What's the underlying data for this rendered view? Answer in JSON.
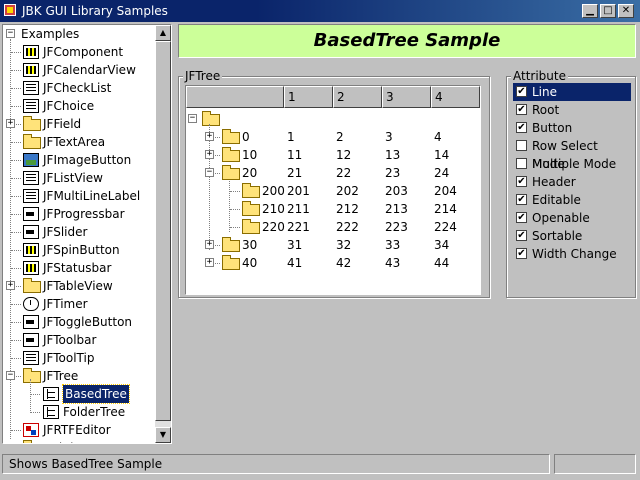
{
  "window": {
    "title": "JBK GUI Library Samples"
  },
  "nav": {
    "root_label": "Examples",
    "items": [
      {
        "label": "JFComponent",
        "icon": "component-icon",
        "expandable": false
      },
      {
        "label": "JFCalendarView",
        "icon": "calendar-icon",
        "expandable": false
      },
      {
        "label": "JFCheckList",
        "icon": "checklist-icon",
        "expandable": false
      },
      {
        "label": "JFChoice",
        "icon": "choice-icon",
        "expandable": false
      },
      {
        "label": "JFField",
        "icon": "folder-icon",
        "expandable": true
      },
      {
        "label": "JFTextArea",
        "icon": "folder-icon",
        "expandable": false
      },
      {
        "label": "JFImageButton",
        "icon": "image-button-icon",
        "expandable": false
      },
      {
        "label": "JFListView",
        "icon": "listview-icon",
        "expandable": false
      },
      {
        "label": "JFMultiLineLabel",
        "icon": "label-icon",
        "expandable": false
      },
      {
        "label": "JFProgressbar",
        "icon": "progressbar-icon",
        "expandable": false
      },
      {
        "label": "JFSlider",
        "icon": "slider-icon",
        "expandable": false
      },
      {
        "label": "JFSpinButton",
        "icon": "spinbutton-icon",
        "expandable": false
      },
      {
        "label": "JFStatusbar",
        "icon": "statusbar-icon",
        "expandable": false
      },
      {
        "label": "JFTableView",
        "icon": "folder-icon",
        "expandable": true
      },
      {
        "label": "JFTimer",
        "icon": "timer-icon",
        "expandable": false
      },
      {
        "label": "JFToggleButton",
        "icon": "toggle-icon",
        "expandable": false
      },
      {
        "label": "JFToolbar",
        "icon": "toolbar-icon",
        "expandable": false
      },
      {
        "label": "JFToolTip",
        "icon": "tooltip-icon",
        "expandable": false
      },
      {
        "label": "JFTree",
        "icon": "folder-open-icon",
        "expandable": true,
        "expanded": true
      },
      {
        "label": "BasedTree",
        "icon": "tree-icon",
        "child": true,
        "selected": true
      },
      {
        "label": "FolderTree",
        "icon": "tree-icon",
        "child": true
      },
      {
        "label": "JFRTFEditor",
        "icon": "rtf-icon",
        "expandable": false
      },
      {
        "label": "DciView",
        "icon": "folder-icon",
        "expandable": false
      }
    ]
  },
  "header": {
    "title": "BasedTree Sample"
  },
  "jftree": {
    "group_title": "JFTree",
    "columns": [
      "",
      "1",
      "2",
      "3",
      "4"
    ],
    "rows": [
      {
        "label": "0",
        "values": [
          "1",
          "2",
          "3",
          "4"
        ],
        "level": 1,
        "expandable": true,
        "expanded": false
      },
      {
        "label": "10",
        "values": [
          "11",
          "12",
          "13",
          "14"
        ],
        "level": 1,
        "expandable": true,
        "expanded": false
      },
      {
        "label": "20",
        "values": [
          "21",
          "22",
          "23",
          "24"
        ],
        "level": 1,
        "expandable": true,
        "expanded": true
      },
      {
        "label": "200",
        "values": [
          "201",
          "202",
          "203",
          "204"
        ],
        "level": 2,
        "expandable": false
      },
      {
        "label": "210",
        "values": [
          "211",
          "212",
          "213",
          "214"
        ],
        "level": 2,
        "expandable": false
      },
      {
        "label": "220",
        "values": [
          "221",
          "222",
          "223",
          "224"
        ],
        "level": 2,
        "expandable": false
      },
      {
        "label": "30",
        "values": [
          "31",
          "32",
          "33",
          "34"
        ],
        "level": 1,
        "expandable": true,
        "expanded": false
      },
      {
        "label": "40",
        "values": [
          "41",
          "42",
          "43",
          "44"
        ],
        "level": 1,
        "expandable": true,
        "expanded": false
      }
    ]
  },
  "attributes": {
    "group_title": "Attribute",
    "items": [
      {
        "label": "Line",
        "checked": true,
        "selected": true
      },
      {
        "label": "Root",
        "checked": true
      },
      {
        "label": "Button",
        "checked": true
      },
      {
        "label": "Row Select Mode",
        "checked": false
      },
      {
        "label": "Multiple Mode",
        "checked": false
      },
      {
        "label": "Header",
        "checked": true
      },
      {
        "label": "Editable",
        "checked": true
      },
      {
        "label": "Openable",
        "checked": true
      },
      {
        "label": "Sortable",
        "checked": true
      },
      {
        "label": "Width Change",
        "checked": true
      }
    ]
  },
  "status": {
    "text": "Shows BasedTree Sample"
  }
}
